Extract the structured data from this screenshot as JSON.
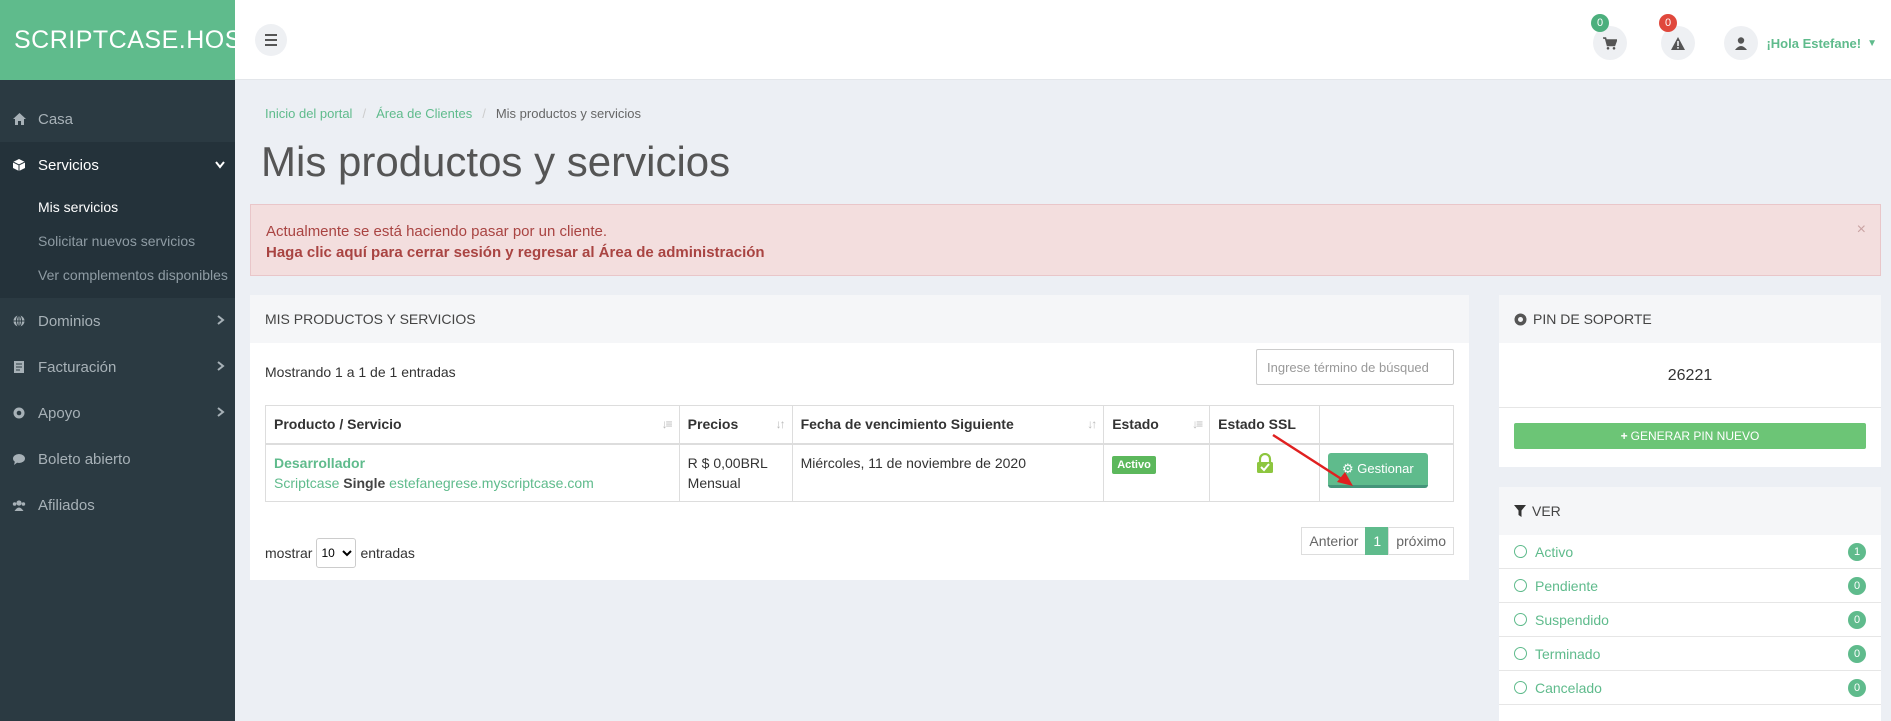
{
  "brand": "SCRIPTCASE.HOST",
  "sidebar": {
    "items": [
      {
        "label": "Casa",
        "icon": "home-icon"
      },
      {
        "label": "Servicios",
        "icon": "cube-icon",
        "active": true,
        "sub": [
          "Mis servicios",
          "Solicitar nuevos servicios",
          "Ver complementos disponibles"
        ]
      },
      {
        "label": "Dominios",
        "icon": "globe-icon"
      },
      {
        "label": "Facturación",
        "icon": "invoice-icon"
      },
      {
        "label": "Apoyo",
        "icon": "lifebuoy-icon"
      },
      {
        "label": "Boleto abierto",
        "icon": "comment-icon"
      },
      {
        "label": "Afiliados",
        "icon": "users-icon"
      }
    ]
  },
  "topbar": {
    "cart_count": "0",
    "alert_count": "0",
    "greeting": "¡Hola Estefane!"
  },
  "breadcrumb": [
    "Inicio del portal",
    "Área de Clientes",
    "Mis productos y servicios"
  ],
  "page_title": "Mis productos y servicios",
  "alert": {
    "line1": "Actualmente se está haciendo pasar por un cliente.",
    "line2": "Haga clic aquí para cerrar sesión y regresar al Área de administración",
    "close": "×"
  },
  "products_panel": {
    "title": "MIS PRODUCTOS Y SERVICIOS",
    "showing": "Mostrando 1 a 1 de 1 entradas",
    "search_placeholder": "Ingrese término de búsqued",
    "columns": [
      "Producto / Servicio",
      "Precios",
      "Fecha de vencimiento Siguiente",
      "Estado",
      "Estado SSL",
      ""
    ],
    "row": {
      "name": "Desarrollador",
      "sub_prefix": "Scriptcase ",
      "sub_bold": "Single",
      "domain": " estefanegrese.myscriptcase.com",
      "price": "R $ 0,00BRL",
      "cycle": "Mensual",
      "due": "Miércoles, 11 de noviembre de 2020",
      "status": "Activo",
      "manage": "Gestionar"
    },
    "show_label": "mostrar",
    "show_value": "10",
    "entries_label": "entradas",
    "pager": [
      "Anterior",
      "1",
      "próximo"
    ]
  },
  "pin_panel": {
    "title": "PIN DE SOPORTE",
    "pin": "26221",
    "button": "GENERAR PIN NUEVO"
  },
  "ver_panel": {
    "title": "VER",
    "items": [
      {
        "label": "Activo",
        "count": "1"
      },
      {
        "label": "Pendiente",
        "count": "0"
      },
      {
        "label": "Suspendido",
        "count": "0"
      },
      {
        "label": "Terminado",
        "count": "0"
      },
      {
        "label": "Cancelado",
        "count": "0"
      }
    ]
  }
}
